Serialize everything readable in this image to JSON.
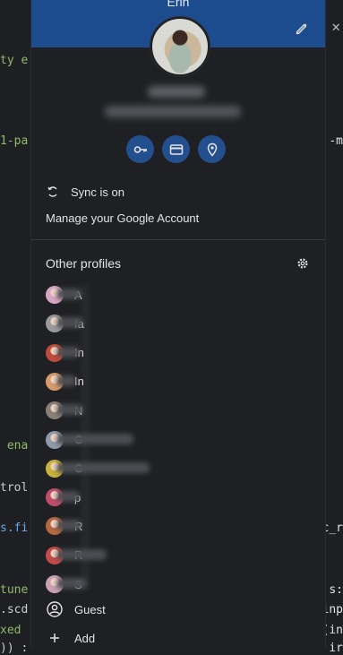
{
  "editor": {
    "lines": [
      {
        "left_text": "ty e",
        "color": "green"
      },
      {
        "left_text": "1-pa",
        "color": "green",
        "right_text": "-m"
      },
      {
        "left_text": " ena",
        "color": "green"
      },
      {
        "left_text": "trol",
        "color": "grey"
      },
      {
        "left_text": "s.fi",
        "color": "blue",
        "right_text": "c_r"
      },
      {
        "left_text": "tune",
        "color": "green",
        "right_text": "s:"
      },
      {
        "left_text": ".scd",
        "color": "grey",
        "right_text": "inp"
      },
      {
        "left_text": "xed",
        "color": "green",
        "right_text": "(in"
      },
      {
        "left_text": ")) :",
        "color": "grey",
        "right_text": "ir"
      }
    ],
    "close_glyph": "✕"
  },
  "profile": {
    "name": "Erin",
    "avatar_icon": "profile-photo",
    "edit_icon": "pencil-icon"
  },
  "quick_actions": [
    {
      "name": "passwords-button",
      "icon": "key-icon"
    },
    {
      "name": "payment-methods-button",
      "icon": "credit-card-icon"
    },
    {
      "name": "addresses-button",
      "icon": "location-pin-icon"
    }
  ],
  "sync": {
    "label": "Sync is on",
    "icon": "sync-icon"
  },
  "manage_account": "Manage your Google Account",
  "other_profiles": {
    "title": "Other profiles",
    "settings_icon": "gear-icon",
    "items": [
      {
        "initial": "A",
        "color": "#d7a6c4"
      },
      {
        "initial": "fa",
        "color": "#9a9a9a"
      },
      {
        "initial": "In",
        "color": "#c04b3a"
      },
      {
        "initial": "In",
        "color": "#d79a6a"
      },
      {
        "initial": "N",
        "color": "#8a7f76"
      },
      {
        "initial": "C",
        "color": "#8e9aa8"
      },
      {
        "initial": "C",
        "color": "#c9b13a"
      },
      {
        "initial": "p",
        "color": "#c24d6a"
      },
      {
        "initial": "R",
        "color": "#b5673f"
      },
      {
        "initial": "R",
        "color": "#c34a4a"
      },
      {
        "initial": "S",
        "color": "#c9a0b4"
      }
    ]
  },
  "guest": {
    "label": "Guest",
    "icon": "person-icon"
  },
  "add": {
    "label": "Add",
    "icon": "plus-icon"
  },
  "colors": {
    "banner": "#1c4b8e",
    "panel": "#1f2023",
    "accent_button": "#244f8f"
  }
}
